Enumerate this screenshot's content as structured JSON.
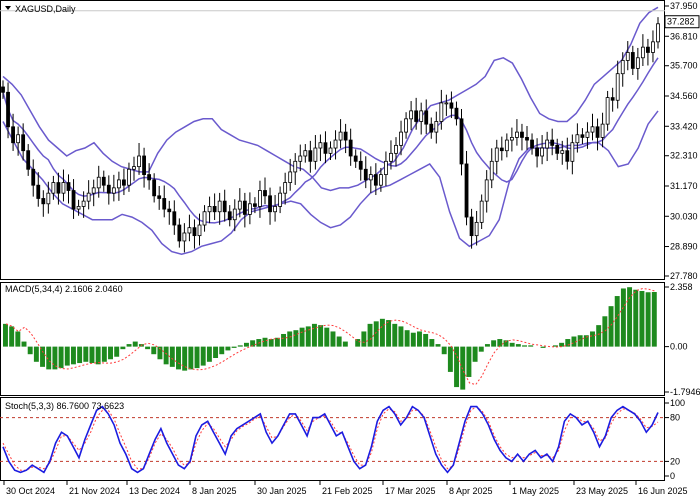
{
  "symbol": "XAGUSD,Daily",
  "main": {
    "price_labels": [
      "37.950",
      "36.810",
      "35.700",
      "34.560",
      "33.420",
      "32.310",
      "31.170",
      "30.030",
      "28.890",
      "27.780"
    ],
    "current_price": "37.282",
    "dropdown_icon": "triangle-down-icon"
  },
  "macd": {
    "label": "MACD(5,34,4) 2.1606 2.0460",
    "axis_labels": [
      "2.358",
      "0.00",
      "-1.7946"
    ]
  },
  "stoch": {
    "label": "Stoch(5,3,3) 86.7600 73.6623",
    "axis_labels": [
      "100",
      "80",
      "20",
      "0"
    ]
  },
  "x_axis": [
    "30 Oct 2024",
    "21 Nov 2024",
    "13 Dec 2024",
    "8 Jan 2025",
    "30 Jan 2025",
    "21 Feb 2025",
    "17 Mar 2025",
    "8 Apr 2025",
    "1 May 2025",
    "23 May 2025",
    "16 Jun 2025"
  ],
  "colors": {
    "candles": "#000000",
    "bollinger": "#6a5acd",
    "macd_hist": "#1e8a1e",
    "macd_signal": "#ff3b3b",
    "stoch_main": "#1c1ce0",
    "stoch_signal": "#ff3b3b",
    "current_price_bg": "#ffffff"
  },
  "chart_data": [
    {
      "type": "candlestick",
      "title": "XAGUSD,Daily",
      "ylim": [
        27.78,
        37.95
      ],
      "closes": [
        34.7,
        33.4,
        32.8,
        33.1,
        32.5,
        31.8,
        31.2,
        30.7,
        30.5,
        30.9,
        31.3,
        30.9,
        31.3,
        31.0,
        30.3,
        30.4,
        30.6,
        30.9,
        31.1,
        31.5,
        31.2,
        30.9,
        31.1,
        31.4,
        31.2,
        31.8,
        31.9,
        32.3,
        31.6,
        31.4,
        30.8,
        30.7,
        30.3,
        30.2,
        29.7,
        29.1,
        29.4,
        29.6,
        29.3,
        29.7,
        30.2,
        30.4,
        30.2,
        30.6,
        30.2,
        29.9,
        30.3,
        30.6,
        30.1,
        30.5,
        30.4,
        31.0,
        30.8,
        30.2,
        30.4,
        30.9,
        31.3,
        31.7,
        32.1,
        32.3,
        32.5,
        32.1,
        32.6,
        32.8,
        32.4,
        32.6,
        32.9,
        33.2,
        32.9,
        32.3,
        32.1,
        31.8,
        31.4,
        31.6,
        31.2,
        31.6,
        32.1,
        32.4,
        32.7,
        33.2,
        33.7,
        34.0,
        33.6,
        34.0,
        33.5,
        33.2,
        33.6,
        34.3,
        34.3,
        34.1,
        33.7,
        32.0,
        30.0,
        29.3,
        29.8,
        30.6,
        31.4,
        32.1,
        32.6,
        32.5,
        32.9,
        33.0,
        33.2,
        33.0,
        32.9,
        32.6,
        32.3,
        32.6,
        32.9,
        32.7,
        32.4,
        32.5,
        32.1,
        32.8,
        33.1,
        33.0,
        33.2,
        33.4,
        33.0,
        33.5,
        34.5,
        34.4,
        35.4,
        35.9,
        36.2,
        35.6,
        36.0,
        36.4,
        36.2,
        36.6,
        37.28
      ],
      "bollinger_upper_approx": [
        35.3,
        35.0,
        34.6,
        34.0,
        33.4,
        32.9,
        32.6,
        32.3,
        32.5,
        32.6,
        32.8,
        32.4,
        32.1,
        31.9,
        31.8,
        31.7,
        31.7,
        32.4,
        32.9,
        33.2,
        33.4,
        33.6,
        33.7,
        33.7,
        33.3,
        33.1,
        32.9,
        32.8,
        32.7,
        32.5,
        32.3,
        32.1,
        31.9,
        31.8,
        31.5,
        31.1,
        31.0,
        31.1,
        31.1,
        31.2,
        31.4,
        31.6,
        31.9,
        32.1,
        32.6,
        33.3,
        33.8,
        34.2,
        34.3,
        34.4,
        34.6,
        34.8,
        35.0,
        35.3,
        35.9,
        36.0,
        35.8,
        35.2,
        34.5,
        33.9,
        33.7,
        33.6,
        33.6,
        33.9,
        34.4,
        35.0,
        35.3,
        35.6,
        35.9,
        36.5,
        37.3,
        37.7,
        37.9
      ],
      "bollinger_lower_approx": [
        33.6,
        32.9,
        32.2,
        31.8,
        31.4,
        30.9,
        30.5,
        30.3,
        30.1,
        29.9,
        29.9,
        29.9,
        30.1,
        30.0,
        29.8,
        29.5,
        29.0,
        28.7,
        28.6,
        28.7,
        28.9,
        29.0,
        29.1,
        29.4,
        29.9,
        30.2,
        30.3,
        30.4,
        30.5,
        30.6,
        30.5,
        30.1,
        29.8,
        29.6,
        29.7,
        30.0,
        30.5,
        30.9,
        31.1,
        31.2,
        31.4,
        31.6,
        31.8,
        32.0,
        31.5,
        30.2,
        29.2,
        28.9,
        29.1,
        29.3,
        29.9,
        31.3,
        32.2,
        32.6,
        32.6,
        32.6,
        32.6,
        32.7,
        32.7,
        32.8,
        32.8,
        32.5,
        31.9,
        32.0,
        32.6,
        33.5,
        34.0
      ]
    },
    {
      "type": "bar",
      "title": "MACD(5,34,4) 2.1606 2.0460",
      "series": [
        {
          "name": "MACD",
          "values": [
            0.9,
            0.8,
            0.6,
            0.2,
            -0.3,
            -0.6,
            -0.8,
            -0.9,
            -0.9,
            -0.85,
            -0.75,
            -0.7,
            -0.65,
            -0.6,
            -0.65,
            -0.7,
            -0.6,
            -0.5,
            -0.4,
            -0.1,
            0.1,
            0.2,
            0.1,
            -0.1,
            -0.3,
            -0.5,
            -0.7,
            -0.8,
            -0.9,
            -0.95,
            -0.9,
            -0.85,
            -0.75,
            -0.6,
            -0.45,
            -0.3,
            -0.15,
            -0.05,
            0.05,
            0.15,
            0.25,
            0.3,
            0.35,
            0.3,
            0.35,
            0.5,
            0.6,
            0.65,
            0.75,
            0.8,
            0.9,
            0.85,
            0.75,
            0.6,
            0.4,
            0.2,
            0.0,
            0.3,
            0.6,
            0.9,
            1.0,
            1.1,
            1.05,
            0.9,
            0.8,
            0.65,
            0.55,
            0.6,
            0.5,
            0.3,
            0.1,
            -0.3,
            -1.0,
            -1.6,
            -1.7,
            -1.2,
            -0.6,
            -0.2,
            0.1,
            0.25,
            0.3,
            0.25,
            0.15,
            0.1,
            0.05,
            0.05,
            0.0,
            -0.05,
            0.0,
            0.05,
            0.15,
            0.3,
            0.4,
            0.45,
            0.45,
            0.6,
            0.85,
            1.2,
            1.6,
            2.0,
            2.3,
            2.35,
            2.25,
            2.2,
            2.15,
            2.16
          ]
        }
      ]
    },
    {
      "type": "line",
      "title": "Stoch(5,3,3) 86.7600 73.6623",
      "ylim": [
        0,
        100
      ],
      "series": [
        {
          "name": "Stoch main",
          "values": [
            40,
            20,
            8,
            5,
            8,
            15,
            10,
            5,
            20,
            45,
            60,
            55,
            40,
            25,
            50,
            70,
            90,
            95,
            85,
            70,
            45,
            30,
            10,
            5,
            10,
            30,
            50,
            65,
            45,
            30,
            15,
            10,
            20,
            55,
            70,
            75,
            60,
            45,
            30,
            55,
            65,
            70,
            75,
            80,
            85,
            60,
            45,
            55,
            70,
            85,
            85,
            70,
            55,
            80,
            80,
            85,
            70,
            55,
            60,
            40,
            20,
            10,
            15,
            40,
            75,
            90,
            95,
            85,
            70,
            80,
            95,
            90,
            80,
            55,
            30,
            15,
            5,
            15,
            45,
            75,
            95,
            95,
            85,
            70,
            50,
            35,
            25,
            20,
            30,
            20,
            30,
            35,
            25,
            30,
            20,
            40,
            75,
            85,
            80,
            70,
            75,
            60,
            40,
            55,
            80,
            90,
            95,
            90,
            85,
            75,
            60,
            70,
            87
          ]
        },
        {
          "name": "Stoch signal",
          "values": [
            45,
            30,
            15,
            8,
            8,
            12,
            12,
            10,
            18,
            35,
            55,
            55,
            45,
            35,
            45,
            60,
            80,
            90,
            90,
            78,
            58,
            40,
            20,
            10,
            10,
            25,
            45,
            58,
            50,
            38,
            22,
            15,
            18,
            45,
            62,
            72,
            65,
            52,
            40,
            50,
            62,
            68,
            72,
            78,
            82,
            68,
            52,
            55,
            68,
            80,
            85,
            75,
            62,
            75,
            80,
            82,
            75,
            62,
            58,
            45,
            28,
            15,
            15,
            32,
            65,
            85,
            92,
            88,
            75,
            78,
            90,
            90,
            82,
            62,
            40,
            22,
            10,
            14,
            38,
            68,
            90,
            95,
            88,
            75,
            55,
            40,
            30,
            25,
            28,
            25,
            28,
            32,
            28,
            28,
            25,
            35,
            62,
            80,
            82,
            75,
            74,
            65,
            48,
            52,
            72,
            85,
            92,
            90,
            86,
            78,
            66,
            68,
            74
          ]
        }
      ]
    }
  ]
}
